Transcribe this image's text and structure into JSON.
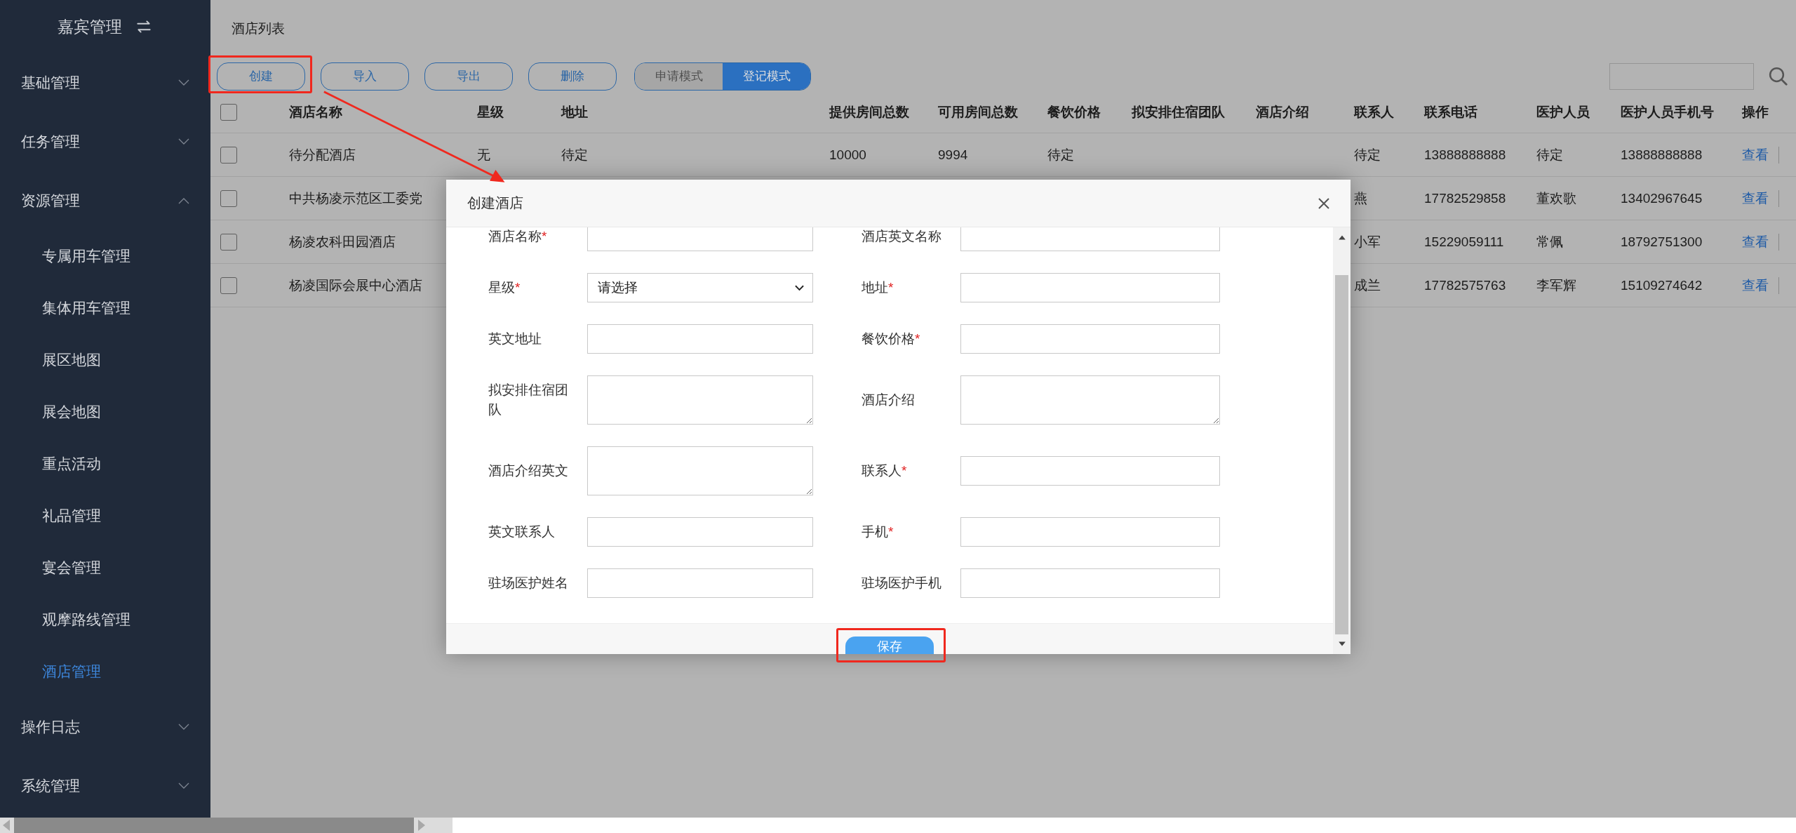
{
  "sidebar": {
    "title": "嘉宾管理",
    "items": [
      {
        "label": "基础管理",
        "expanded": false,
        "selected": false
      },
      {
        "label": "任务管理",
        "expanded": false,
        "selected": false
      },
      {
        "label": "资源管理",
        "expanded": true,
        "selected": false,
        "children": [
          {
            "label": "专属用车管理",
            "selected": false
          },
          {
            "label": "集体用车管理",
            "selected": false
          },
          {
            "label": "展区地图",
            "selected": false
          },
          {
            "label": "展会地图",
            "selected": false
          },
          {
            "label": "重点活动",
            "selected": false
          },
          {
            "label": "礼品管理",
            "selected": false
          },
          {
            "label": "宴会管理",
            "selected": false
          },
          {
            "label": "观摩路线管理",
            "selected": false
          },
          {
            "label": "酒店管理",
            "selected": true
          }
        ]
      },
      {
        "label": "操作日志",
        "expanded": false,
        "selected": false
      },
      {
        "label": "系统管理",
        "expanded": false,
        "selected": false
      }
    ]
  },
  "page_title": "酒店列表",
  "toolbar": {
    "buttons": [
      "创建",
      "导入",
      "导出",
      "删除"
    ],
    "modes": [
      {
        "label": "申请模式",
        "selected": false
      },
      {
        "label": "登记模式",
        "selected": true
      }
    ]
  },
  "table": {
    "select_all": {
      "checked": false
    },
    "columns": [
      "酒店名称",
      "星级",
      "地址",
      "提供房间总数",
      "可用房间总数",
      "餐饮价格",
      "拟安排住宿团队",
      "酒店介绍",
      "联系人",
      "联系电话",
      "医护人员",
      "医护人员手机号",
      "操作"
    ],
    "rows": [
      {
        "checked": false,
        "cells": [
          "待分配酒店",
          "无",
          "待定",
          "10000",
          "9994",
          "待定",
          null,
          null,
          "待定",
          "13888888888",
          "待定",
          "13888888888"
        ],
        "action": "查看"
      },
      {
        "checked": false,
        "cells": [
          "中共杨凌示范区工委党",
          null,
          null,
          null,
          null,
          null,
          null,
          null,
          "燕",
          "17782529858",
          "董欢歌",
          "13402967645"
        ],
        "action": "查看"
      },
      {
        "checked": false,
        "cells": [
          "杨凌农科田园酒店",
          null,
          null,
          null,
          null,
          null,
          null,
          null,
          "小军",
          "15229059111",
          "常佩",
          "18792751300"
        ],
        "action": "查看"
      },
      {
        "checked": false,
        "cells": [
          "杨凌国际会展中心酒店",
          null,
          null,
          null,
          null,
          null,
          null,
          null,
          "成兰",
          "17782575763",
          "李军辉",
          "15109274642"
        ],
        "action": "查看"
      }
    ]
  },
  "dialog": {
    "title": "创建酒店",
    "rows": [
      [
        {
          "label": "酒店名称",
          "mark": "*",
          "kind": "text"
        },
        {
          "label": "酒店英文名称",
          "kind": "text"
        }
      ],
      [
        {
          "label": "星级",
          "mark": "*",
          "kind": "select",
          "value": "请选择"
        },
        {
          "label": "地址",
          "mark": "*",
          "kind": "text"
        }
      ],
      [
        {
          "label": "英文地址",
          "kind": "text"
        },
        {
          "label": "餐饮价格",
          "mark": "*",
          "kind": "text"
        }
      ],
      [
        {
          "label": "拟安排住宿团队",
          "kind": "textarea"
        },
        {
          "label": "酒店介绍",
          "kind": "textarea"
        }
      ],
      [
        {
          "label": "酒店介绍英文",
          "kind": "textarea"
        },
        {
          "label": "联系人",
          "mark": "*",
          "kind": "text"
        }
      ],
      [
        {
          "label": "英文联系人",
          "kind": "text"
        },
        {
          "label": "手机",
          "mark": "*",
          "kind": "text"
        }
      ],
      [
        {
          "label": "驻场医护姓名",
          "kind": "text"
        },
        {
          "label": "驻场医护手机",
          "kind": "text"
        }
      ]
    ],
    "save_button": "保存"
  }
}
